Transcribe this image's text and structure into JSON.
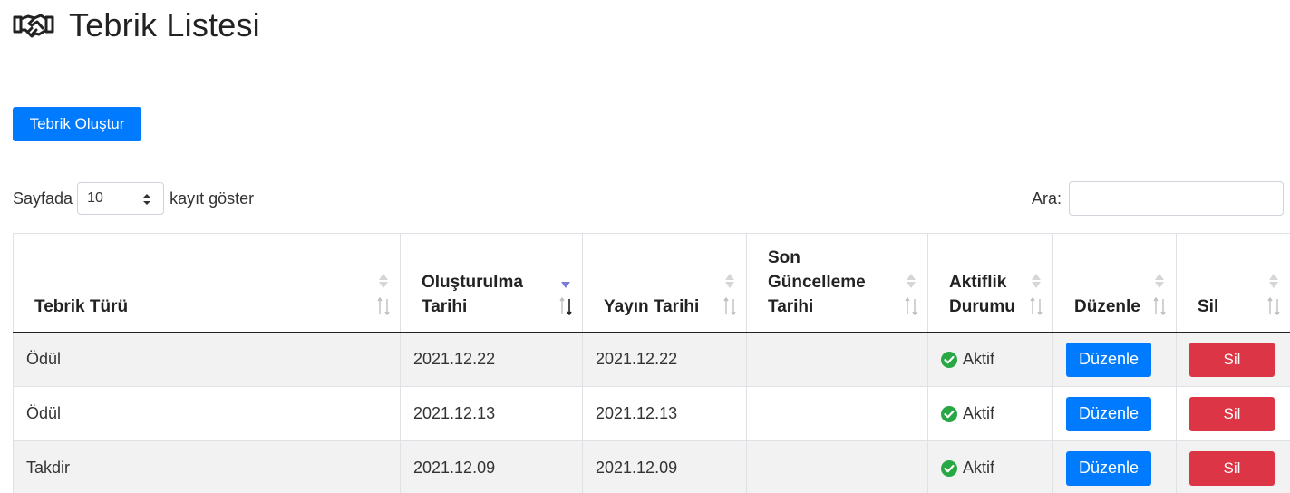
{
  "page": {
    "title": "Tebrik Listesi",
    "title_icon": "handshake-icon"
  },
  "actions": {
    "create_label": "Tebrik Oluştur"
  },
  "length": {
    "prefix": "Sayfada",
    "value": "10",
    "suffix": "kayıt göster"
  },
  "search": {
    "label": "Ara:",
    "value": ""
  },
  "table": {
    "columns": [
      "Tebrik Türü",
      "Oluşturulma Tarihi",
      "Yayın Tarihi",
      "Son Güncelleme Tarihi",
      "Aktiflik Durumu",
      "Düzenle",
      "Sil"
    ],
    "sorted_column": "Oluşturulma Tarihi",
    "rows": [
      {
        "type": "Ödül",
        "created": "2021.12.22",
        "published": "2021.12.22",
        "updated": "",
        "status": "Aktif",
        "edit": "Düzenle",
        "delete": "Sil"
      },
      {
        "type": "Ödül",
        "created": "2021.12.13",
        "published": "2021.12.13",
        "updated": "",
        "status": "Aktif",
        "edit": "Düzenle",
        "delete": "Sil"
      },
      {
        "type": "Takdir",
        "created": "2021.12.09",
        "published": "2021.12.09",
        "updated": "",
        "status": "Aktif",
        "edit": "Düzenle",
        "delete": "Sil"
      }
    ]
  },
  "colors": {
    "primary": "#007bff",
    "danger": "#dc3545",
    "success": "#28a745",
    "sort_active": "#7b7bd8"
  }
}
